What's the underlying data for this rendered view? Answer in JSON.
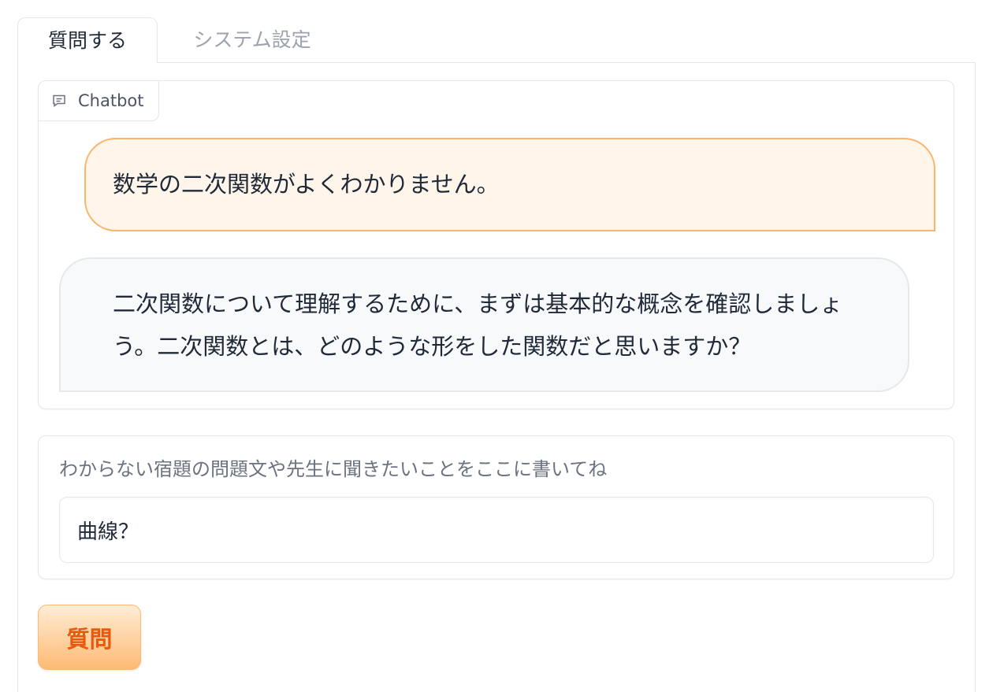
{
  "tabs": [
    {
      "label": "質問する",
      "active": true
    },
    {
      "label": "システム設定",
      "active": false
    }
  ],
  "chatbot": {
    "label": "Chatbot",
    "icon": "chat-icon",
    "messages": [
      {
        "role": "user",
        "text": "数学の二次関数がよくわかりません。"
      },
      {
        "role": "bot",
        "text": "二次関数について理解するために、まずは基本的な概念を確認しましょう。二次関数とは、どのような形をした関数だと思いますか？"
      }
    ]
  },
  "question_input": {
    "label": "わからない宿題の問題文や先生に聞きたいことをここに書いてね",
    "value": "曲線？"
  },
  "submit_button": {
    "label": "質問"
  },
  "colors": {
    "accent": "#ea580c",
    "user_bubble_bg": "#fff5ea",
    "user_bubble_border": "#fbb56b",
    "bot_bubble_bg": "#f8f9fb",
    "border": "#e5e7eb"
  }
}
